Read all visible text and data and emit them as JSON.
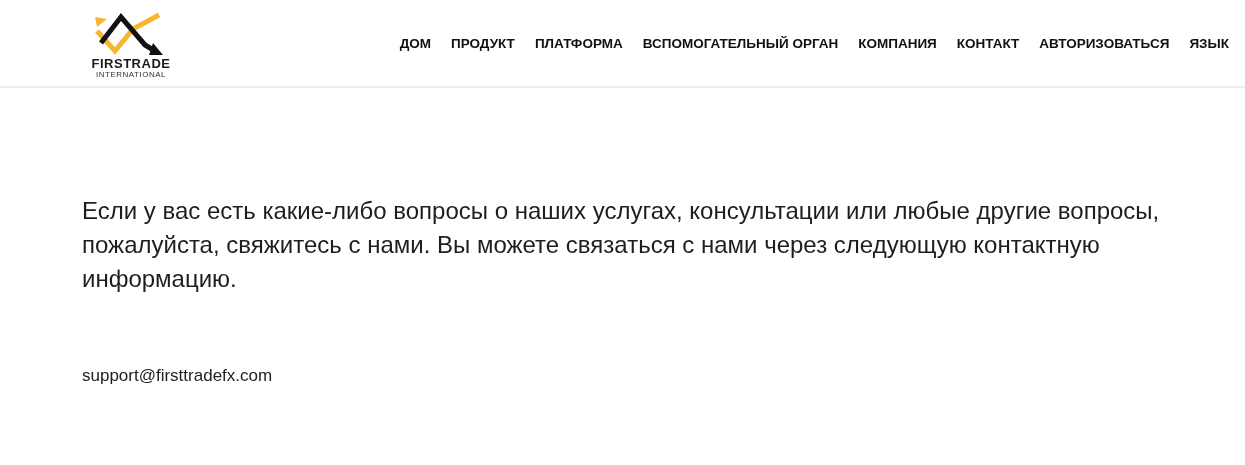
{
  "logo": {
    "name": "FIRSTRADE",
    "tagline": "INTERNATIONAL"
  },
  "nav": [
    {
      "label": "ДОМ"
    },
    {
      "label": "ПРОДУКТ"
    },
    {
      "label": "ПЛАТФОРМА"
    },
    {
      "label": "ВСПОМОГАТЕЛЬНЫЙ ОРГАН"
    },
    {
      "label": "КОМПАНИЯ"
    },
    {
      "label": "КОНТАКТ"
    },
    {
      "label": "АВТОРИЗОВАТЬСЯ"
    },
    {
      "label": "ЯЗЫК"
    }
  ],
  "intro": "Если у вас есть какие-либо вопросы о наших услугах, консультации или любые другие вопросы, пожалуйста, свяжитесь с нами. Вы можете связаться с нами через следующую контактную информацию.",
  "email": "support@firsttradefx.com"
}
